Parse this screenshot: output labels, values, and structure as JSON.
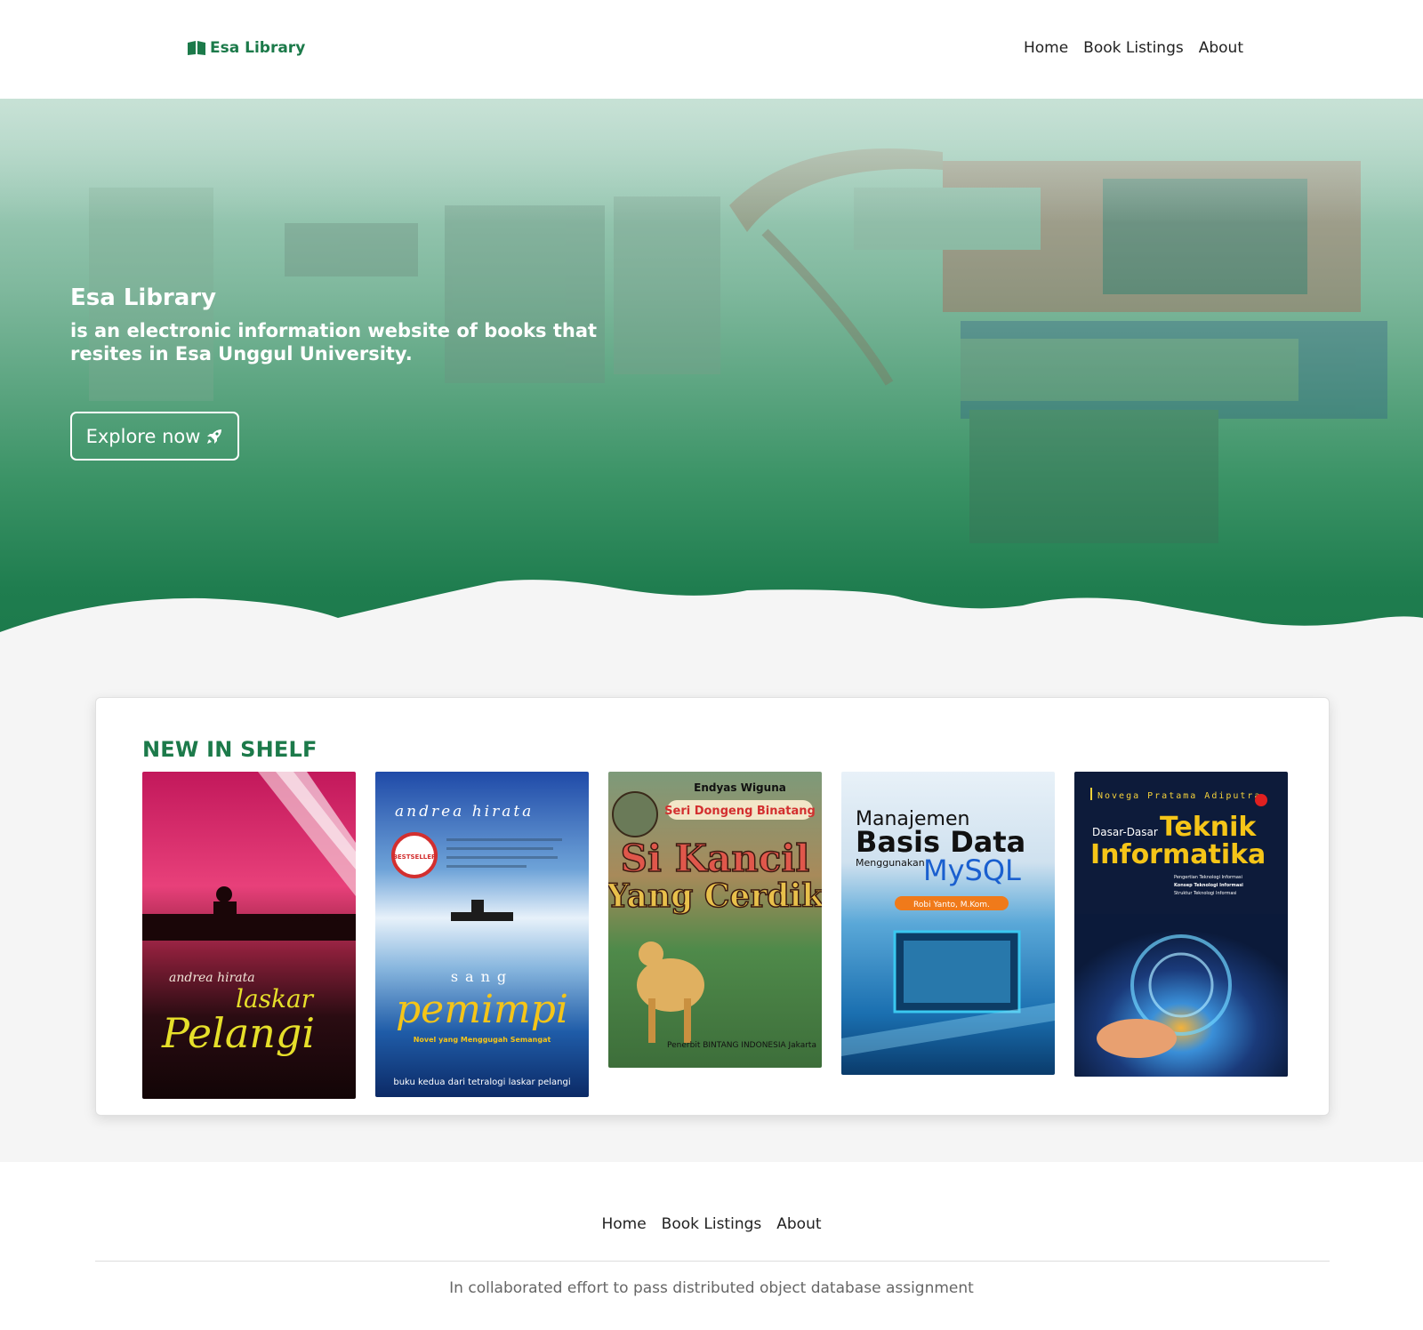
{
  "navbar": {
    "brand": "Esa Library",
    "brand_icon": "open-book-icon",
    "links": [
      "Home",
      "Book Listings",
      "About"
    ]
  },
  "hero": {
    "title": "Esa Library",
    "subtitle": "is an electronic information website of books that resites in Esa Unggul University.",
    "button_label": "Explore now",
    "button_icon": "rocket-icon"
  },
  "shelf": {
    "title": "NEW IN SHELF",
    "books": [
      {
        "title": "Pelangi",
        "title2": "laskar",
        "author": "andrea hirata"
      },
      {
        "title": "pemimpi",
        "title2": "sang",
        "author": "andrea hirata",
        "tagline": "Novel yang Menggugah Semangat",
        "footer": "buku kedua dari tetralogi laskar pelangi",
        "badge": "BESTSELLER"
      },
      {
        "author": "Endyas Wiguna",
        "series": "Seri Dongeng Binatang",
        "title": "Si Kancil",
        "title2": "Yang Cerdik",
        "publisher": "Penerbit BINTANG INDONESIA Jakarta"
      },
      {
        "title": "Manajemen",
        "title2": "Basis Data",
        "sub": "Menggunakan",
        "title3": "MySQL",
        "author": "Robi Yanto, M.Kom."
      },
      {
        "author": "Novega Pratama Adiputra",
        "pre": "Dasar-Dasar",
        "title": "Teknik",
        "title2": "Informatika",
        "bullets": [
          "Pengertian Teknologi Informasi",
          "Konsep Teknologi Informasi",
          "Struktur Teknologi Informasi"
        ]
      }
    ]
  },
  "footer": {
    "links": [
      "Home",
      "Book Listings",
      "About"
    ],
    "note": "In collaborated effort to pass distributed object database assignment"
  },
  "colors": {
    "brand_green": "#1c7a4a",
    "hero_green": "#1e7d4e"
  }
}
